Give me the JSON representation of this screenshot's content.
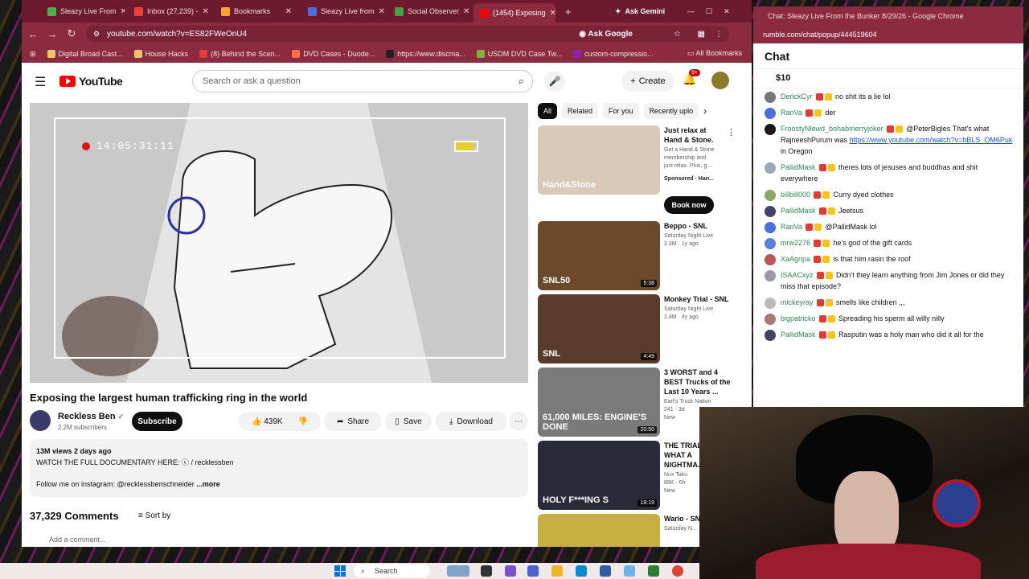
{
  "tabs": [
    {
      "label": "Sleazy Live From",
      "color": "#4caf50"
    },
    {
      "label": "Inbox (27,239) -",
      "color": "#ea4335"
    },
    {
      "label": "Bookmarks",
      "color": "#f9a825"
    },
    {
      "label": "Sleazy Live from",
      "color": "#4a6ee0"
    },
    {
      "label": "Social Observer",
      "color": "#43a047"
    },
    {
      "label": "(1454) Exposing",
      "color": "#ff0000"
    }
  ],
  "ask_gemini": "Ask Gemini",
  "address": "youtube.com/watch?v=ES82FWeOnU4",
  "ask_google": "Ask Google",
  "bookmarks": [
    "Digital Broad Cast...",
    "House Hacks",
    "(8) Behind the Scen...",
    "DVD Cases - Duode...",
    "https://www.discma...",
    "USDM DVD Case Tw...",
    "custom-compressio..."
  ],
  "all_bookmarks": "All Bookmarks",
  "youtube": {
    "logo": "YouTube",
    "search_placeholder": "Search or ask a question",
    "create_label": "Create",
    "notif_count": "9+"
  },
  "video": {
    "timestamp": "14:05:31:11",
    "title": "Exposing the largest human trafficking ring in the world",
    "channel": "Reckless Ben",
    "subscribers": "2.2M subscribers",
    "subscribe_label": "Subscribe",
    "likes": "439K",
    "share_label": "Share",
    "save_label": "Save",
    "download_label": "Download",
    "views_date": "13M views  2 days ago",
    "desc_line1": "WATCH THE FULL DOCUMENTARY HERE:  ⓒ / recklessben",
    "desc_line2": "Follow me on instagram: @recklessbenschneider",
    "more_label": "...more",
    "comments_count": "37,329 Comments",
    "sort_label": "Sort by",
    "add_comment": "Add a comment..."
  },
  "filters": [
    "All",
    "Related",
    "For you",
    "Recently uplo"
  ],
  "related": [
    {
      "title": "Just relax at\nHand & Stone.",
      "meta": "Get a Hand & Stone\nmembership and\njust relax. Plus, g...",
      "extra": "Sponsored · Han...",
      "cta": "Book now",
      "duration": "",
      "thumb": "#d9c9b8",
      "thumb_text": "Hand&Stone"
    },
    {
      "title": "Beppo - SNL",
      "meta": "Saturday Night Live\n2.3M · 1y ago",
      "extra": "",
      "cta": "",
      "duration": "5:38",
      "thumb": "#6a4a2a",
      "thumb_text": "SNL50"
    },
    {
      "title": "Monkey Trial - SNL",
      "meta": "Saturday Night Live\n2.8M · 4y ago",
      "extra": "",
      "cta": "",
      "duration": "4:49",
      "thumb": "#5a3a2a",
      "thumb_text": "SNL"
    },
    {
      "title": "3 WORST and 4\nBEST Trucks of the\nLast 10 Years ...",
      "meta": "Earl's Truck Nation\n241 · 3d\nNew",
      "extra": "",
      "cta": "",
      "duration": "20:50",
      "thumb": "#7a7a7a",
      "thumb_text": "61,000 MILES: ENGINE'S DONE"
    },
    {
      "title": "THE TRIAL\nWHAT A\nNIGHTMA...",
      "meta": "Nux Taku\n88K · 6h\nNew",
      "extra": "",
      "cta": "",
      "duration": "18:19",
      "thumb": "#2a2a3a",
      "thumb_text": "HOLY F***ING S"
    },
    {
      "title": "Wario - SN...",
      "meta": "Saturday N...",
      "extra": "",
      "cta": "",
      "duration": "",
      "thumb": "#c8b040",
      "thumb_text": ""
    }
  ],
  "chat": {
    "window_title": "Chat: Sleazy Live From the Bunker 8/29/26 - Google Chrome",
    "url": "rumble.com/chat/popup/444519604",
    "header": "Chat",
    "tip": "$10",
    "messages": [
      {
        "user": "DerickCyr",
        "color": "#2e8b57",
        "text": "no shit its a lie lol"
      },
      {
        "user": "RanVa",
        "color": "#2e8b57",
        "text": "der"
      },
      {
        "user": "FroostyNlewd_bohabmerryjoker",
        "color": "#2e8b57",
        "text": "@PeterBigles That's what RajneeshPurum was ",
        "link": "https://www.youtube.com/watch?v=hBLS_OM6Puk",
        "after": " in Oregon"
      },
      {
        "user": "PallidMask",
        "color": "#2e8b57",
        "text": "theres lots of jesuses and buddhas and shit everywhere"
      },
      {
        "user": "billbill000",
        "color": "#2e8b57",
        "text": "Curry dyed clothes"
      },
      {
        "user": "PallidMask",
        "color": "#2e8b57",
        "text": "Jeetsus"
      },
      {
        "user": "RanVa",
        "color": "#2e8b57",
        "text": "@PallidMask lol"
      },
      {
        "user": "mrw2276",
        "color": "#2e8b57",
        "text": "he's god of the gift cards"
      },
      {
        "user": "XaAgripa",
        "color": "#2e8b57",
        "text": "is that him rasin the roof"
      },
      {
        "user": "ISAACxyz",
        "color": "#2e8b57",
        "text": "Didn't they learn anything from Jim Jones or did they miss that episode?"
      },
      {
        "user": "mickeyray",
        "color": "#2e8b57",
        "text": "smells like children ,,,"
      },
      {
        "user": "bigpatricko",
        "color": "#2e8b57",
        "text": "Spreading his sperm all willy nilly"
      },
      {
        "user": "PallidMask",
        "color": "#2e8b57",
        "text": "Rasputin was a holy man who did it all for the"
      }
    ]
  },
  "taskbar": {
    "search": "Search"
  }
}
